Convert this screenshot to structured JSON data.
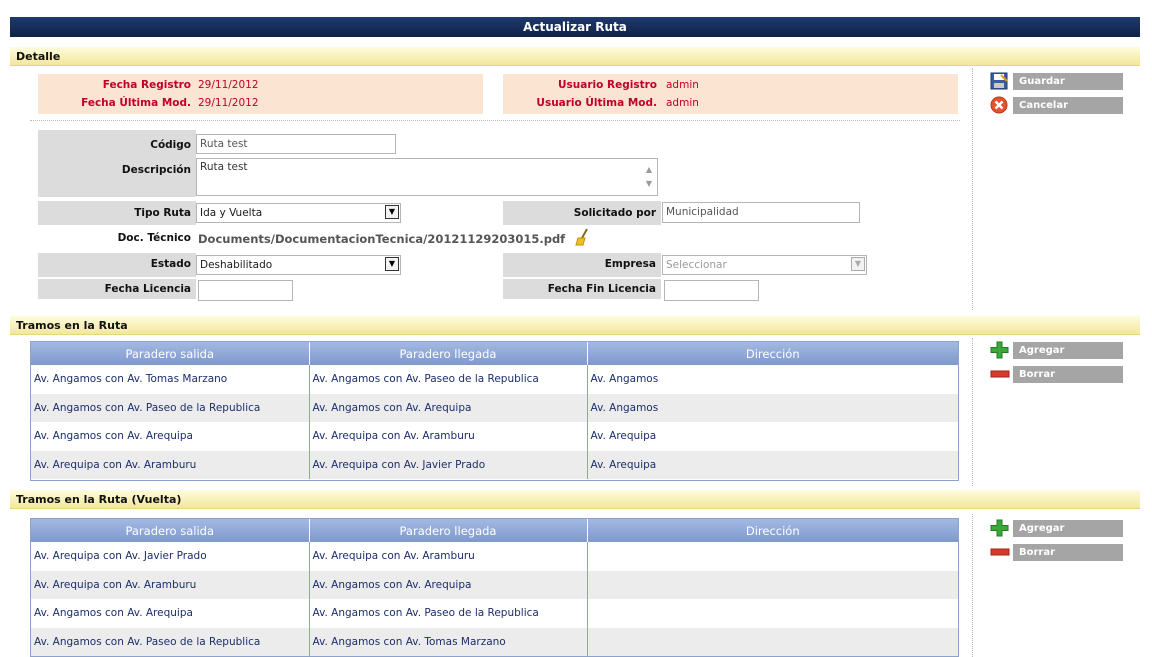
{
  "title": "Actualizar Ruta",
  "detalle": {
    "header": "Detalle",
    "fecha_registro_label": "Fecha Registro",
    "fecha_registro_value": "29/11/2012",
    "fecha_mod_label": "Fecha Última Mod.",
    "fecha_mod_value": "29/11/2012",
    "usuario_registro_label": "Usuario Registro",
    "usuario_registro_value": "admin",
    "usuario_mod_label": "Usuario Última Mod.",
    "usuario_mod_value": "admin"
  },
  "actions": {
    "save_label": "Guardar",
    "cancel_label": "Cancelar"
  },
  "form": {
    "codigo_label": "Código",
    "codigo_value": "Ruta test",
    "descripcion_label": "Descripción",
    "descripcion_value": "Ruta test",
    "tipo_ruta_label": "Tipo Ruta",
    "tipo_ruta_value": "Ida y Vuelta",
    "solicitado_label": "Solicitado por",
    "solicitado_value": "Municipalidad",
    "doc_label": "Doc. Técnico",
    "doc_value": "Documents/DocumentacionTecnica/20121129203015.pdf",
    "estado_label": "Estado",
    "estado_value": "Deshabilitado",
    "empresa_label": "Empresa",
    "empresa_value": "Seleccionar",
    "fecha_licencia_label": "Fecha Licencia",
    "fecha_licencia_value": "",
    "fecha_fin_label": "Fecha Fin Licencia",
    "fecha_fin_value": ""
  },
  "tramos": {
    "header": "Tramos en la Ruta",
    "columns": [
      "Paradero salida",
      "Paradero llegada",
      "Dirección"
    ],
    "rows": [
      [
        "Av. Angamos con Av. Tomas Marzano",
        "Av. Angamos con Av. Paseo de la Republica",
        "Av. Angamos"
      ],
      [
        "Av. Angamos con Av. Paseo de la Republica",
        "Av. Angamos con Av. Arequipa",
        "Av. Angamos"
      ],
      [
        "Av. Angamos con Av. Arequipa",
        "Av. Arequipa con Av. Aramburu",
        "Av. Arequipa"
      ],
      [
        "Av. Arequipa con Av. Aramburu",
        "Av. Arequipa con Av. Javier Prado",
        "Av. Arequipa"
      ]
    ],
    "add_label": "Agregar",
    "delete_label": "Borrar"
  },
  "tramos_vuelta": {
    "header": "Tramos en la Ruta (Vuelta)",
    "columns": [
      "Paradero salida",
      "Paradero llegada",
      "Dirección"
    ],
    "rows": [
      [
        "Av. Arequipa con Av. Javier Prado",
        "Av. Arequipa con Av. Aramburu",
        ""
      ],
      [
        "Av. Arequipa con Av. Aramburu",
        "Av. Angamos con Av. Arequipa",
        ""
      ],
      [
        "Av. Angamos con Av. Arequipa",
        "Av. Angamos con Av. Paseo de la Republica",
        ""
      ],
      [
        "Av. Angamos con Av. Paseo de la Republica",
        "Av. Angamos con Av. Tomas Marzano",
        ""
      ]
    ],
    "add_label": "Agregar",
    "delete_label": "Borrar"
  },
  "icons": {
    "save": "floppy-disk-icon",
    "cancel": "cancel-icon",
    "add": "plus-icon",
    "delete": "minus-icon",
    "upload": "broom-icon",
    "dropdown": "chevron-down-icon"
  }
}
